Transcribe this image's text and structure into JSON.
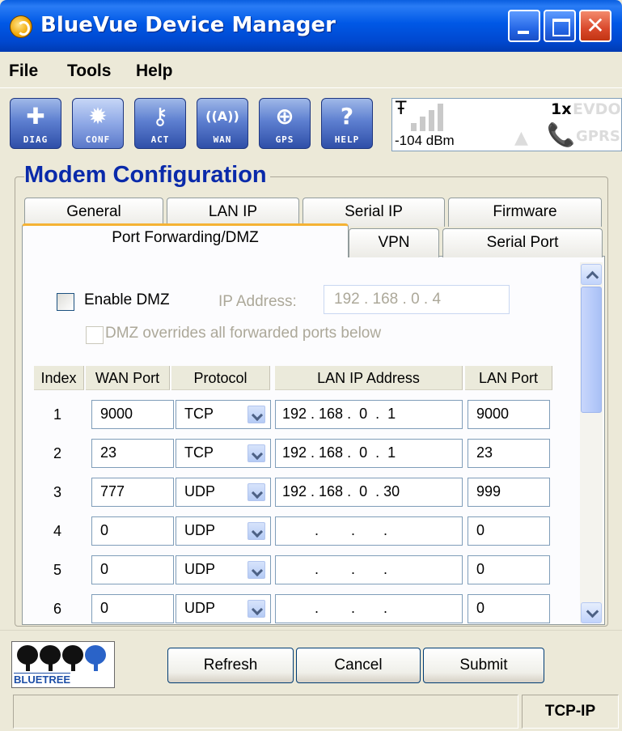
{
  "window": {
    "title": "BlueVue Device Manager",
    "close_glyph": "✕"
  },
  "menu": {
    "items": [
      "File",
      "Tools",
      "Help"
    ]
  },
  "toolbar": {
    "buttons": [
      {
        "label": "DIAG",
        "icon": "plus-icon",
        "glyph": "✚"
      },
      {
        "label": "CONF",
        "icon": "gear-icon",
        "glyph": "✹"
      },
      {
        "label": "ACT",
        "icon": "key-icon",
        "glyph": "⚷"
      },
      {
        "label": "WAN",
        "icon": "antenna-icon",
        "glyph": "((A))"
      },
      {
        "label": "GPS",
        "icon": "globe-icon",
        "glyph": "⊕"
      },
      {
        "label": "HELP",
        "icon": "question-icon",
        "glyph": "?"
      }
    ]
  },
  "signal": {
    "dbm": "-104 dBm",
    "net_1x": "1x",
    "net_evdo": "EVDO",
    "net_gprs": "GPRS",
    "antenna_glyph": "Ŧ",
    "phone_glyph": "📞",
    "triangle_glyph": "▲"
  },
  "group": {
    "title": "Modem Configuration"
  },
  "tabs": {
    "row1": [
      "General",
      "LAN IP",
      "Serial IP",
      "Firmware"
    ],
    "row2": [
      "Port Forwarding/DMZ",
      "VPN",
      "Serial Port"
    ],
    "active": "Port Forwarding/DMZ"
  },
  "dmz": {
    "enable_label": "Enable DMZ",
    "enable_checked": false,
    "ip_label": "IP Address:",
    "ip_value": "192 . 168 .  0  .  4",
    "override_label": "DMZ overrides all forwarded ports below",
    "override_checked": false
  },
  "table": {
    "headers": [
      "Index",
      "WAN Port",
      "Protocol",
      "LAN IP Address",
      "LAN Port"
    ],
    "rows": [
      {
        "index": "1",
        "wan_port": "9000",
        "protocol": "TCP",
        "lan_ip": "192 . 168 .  0  .  1",
        "lan_port": "9000"
      },
      {
        "index": "2",
        "wan_port": "23",
        "protocol": "TCP",
        "lan_ip": "192 . 168 .  0  .  1",
        "lan_port": "23"
      },
      {
        "index": "3",
        "wan_port": "777",
        "protocol": "UDP",
        "lan_ip": "192 . 168 .  0  . 30",
        "lan_port": "999"
      },
      {
        "index": "4",
        "wan_port": "0",
        "protocol": "UDP",
        "lan_ip": "        .        .       .",
        "lan_port": "0"
      },
      {
        "index": "5",
        "wan_port": "0",
        "protocol": "UDP",
        "lan_ip": "        .        .       .",
        "lan_port": "0"
      },
      {
        "index": "6",
        "wan_port": "0",
        "protocol": "UDP",
        "lan_ip": "        .        .       .",
        "lan_port": "0"
      }
    ]
  },
  "logo": {
    "text": "BLUETREE"
  },
  "actions": {
    "refresh": "Refresh",
    "cancel": "Cancel",
    "submit": "Submit"
  },
  "status": {
    "left": "",
    "mode": "TCP-IP"
  }
}
